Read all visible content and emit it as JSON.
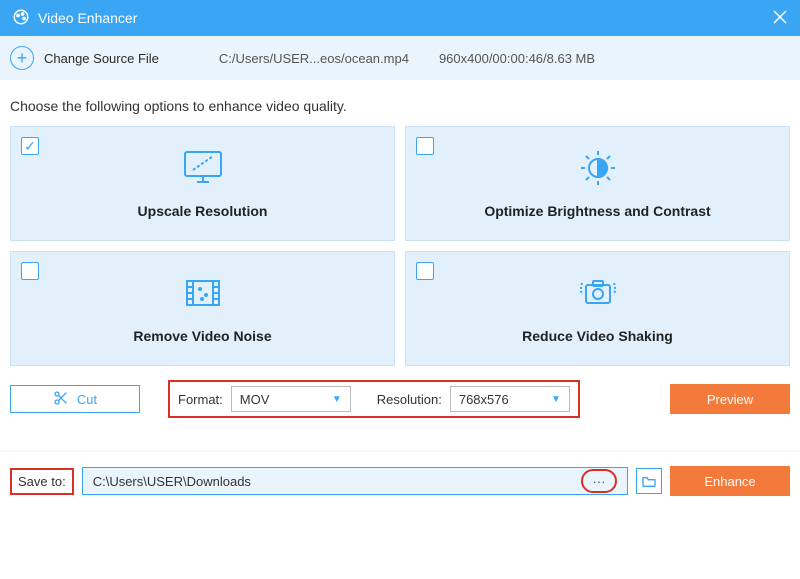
{
  "window": {
    "title": "Video Enhancer"
  },
  "source": {
    "change_label": "Change Source File",
    "path": "C:/Users/USER...eos/ocean.mp4",
    "info": "960x400/00:00:46/8.63 MB"
  },
  "instruction": "Choose the following options to enhance video quality.",
  "options": [
    {
      "label": "Upscale Resolution",
      "checked": true
    },
    {
      "label": "Optimize Brightness and Contrast",
      "checked": false
    },
    {
      "label": "Remove Video Noise",
      "checked": false
    },
    {
      "label": "Reduce Video Shaking",
      "checked": false
    }
  ],
  "cut": {
    "label": "Cut"
  },
  "format": {
    "label": "Format:",
    "value": "MOV"
  },
  "resolution": {
    "label": "Resolution:",
    "value": "768x576"
  },
  "preview": {
    "label": "Preview"
  },
  "save": {
    "label": "Save to:",
    "path": "C:\\Users\\USER\\Downloads",
    "ellipsis": "···"
  },
  "enhance": {
    "label": "Enhance"
  }
}
